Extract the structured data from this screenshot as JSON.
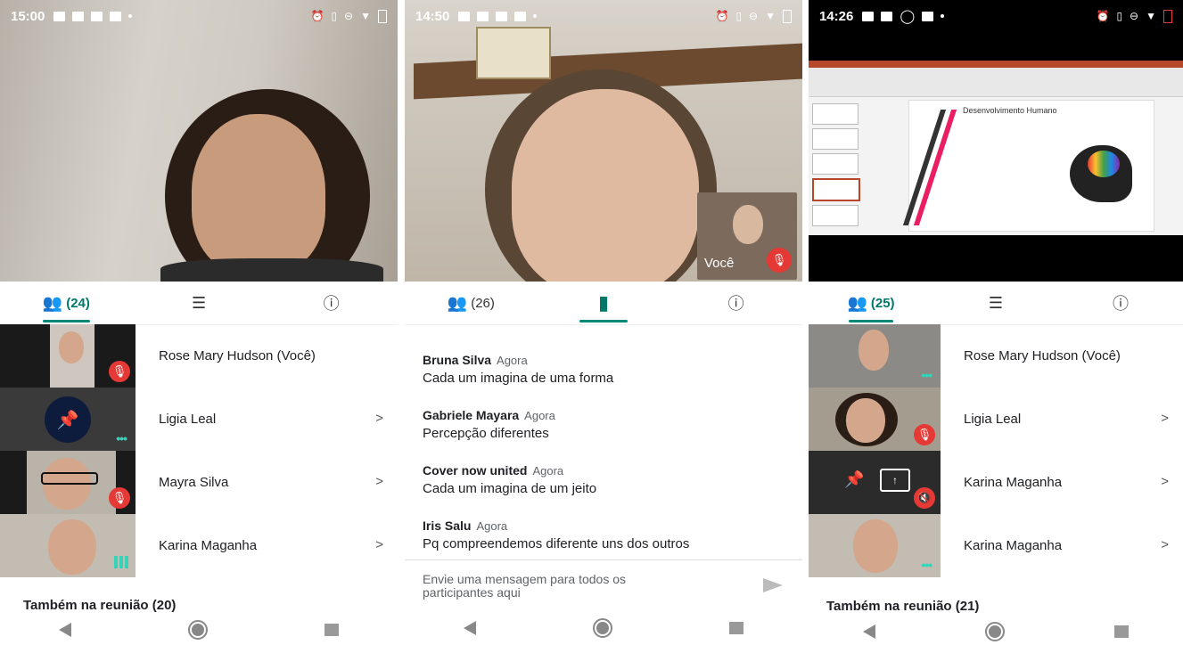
{
  "phones": [
    {
      "status_time": "15:00",
      "tabs": {
        "people_count": "(24)"
      },
      "participants": [
        {
          "name": "Rose Mary Hudson (Você)"
        },
        {
          "name": "Ligia Leal"
        },
        {
          "name": "Mayra Silva"
        },
        {
          "name": "Karina Maganha"
        }
      ],
      "also_in_meeting": "Também na reunião (20)"
    },
    {
      "status_time": "14:50",
      "tabs": {
        "people_count": "(26)"
      },
      "self_view_label": "Você",
      "messages": [
        {
          "author": "Bruna Silva",
          "time": "Agora",
          "text": "Cada um imagina de uma forma"
        },
        {
          "author": "Gabriele Mayara",
          "time": "Agora",
          "text": "Percepção diferentes"
        },
        {
          "author": "Cover now united",
          "time": "Agora",
          "text": "Cada um imagina de um jeito"
        },
        {
          "author": "Iris Salu",
          "time": "Agora",
          "text": "Pq compreendemos diferente  uns dos outros"
        }
      ],
      "composer_placeholder": "Envie uma mensagem para todos os participantes aqui"
    },
    {
      "status_time": "14:26",
      "slide_title": "Desenvolvimento Humano",
      "tabs": {
        "people_count": "(25)"
      },
      "participants": [
        {
          "name": "Rose Mary Hudson (Você)"
        },
        {
          "name": "Ligia Leal"
        },
        {
          "name": "Karina Maganha"
        },
        {
          "name": "Karina Maganha"
        }
      ],
      "also_in_meeting": "Também na reunião (21)"
    }
  ],
  "colors": {
    "accent": "#00897b",
    "mic_off": "#e53935",
    "speaking": "#37d3b8"
  }
}
